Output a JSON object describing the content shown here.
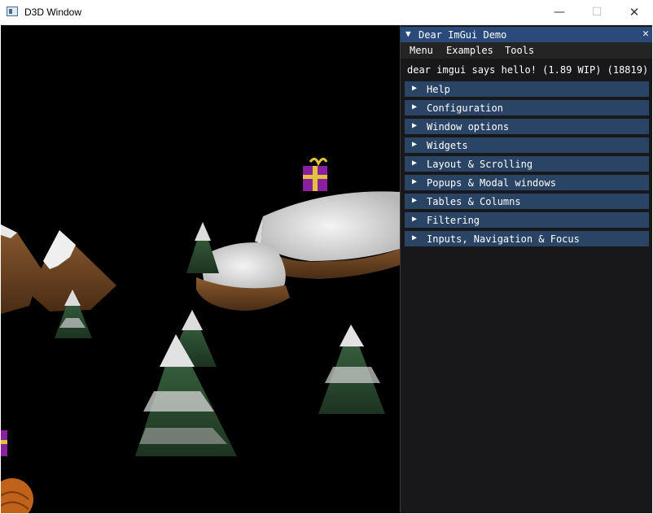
{
  "window": {
    "title": "D3D Window",
    "minimize_glyph": "—",
    "maximize_glyph": "☐",
    "close_glyph": "✕"
  },
  "imgui": {
    "title": "Dear ImGui Demo",
    "collapse_glyph": "▼",
    "close_glyph": "✕",
    "menu": [
      "Menu",
      "Examples",
      "Tools"
    ],
    "hello_text": "dear imgui says hello! (1.89 WIP) (18819)",
    "header_arrow": "▶",
    "headers": [
      "Help",
      "Configuration",
      "Window options",
      "Widgets",
      "Layout & Scrolling",
      "Popups & Modal windows",
      "Tables & Columns",
      "Filtering",
      "Inputs, Navigation & Focus"
    ]
  },
  "colors": {
    "imgui_title_bg": "#294a7a",
    "imgui_header_bg": "#2a4466",
    "imgui_menubar_bg": "#242424",
    "imgui_window_bg": "#0f0f11",
    "scene_bg": "#000000"
  }
}
